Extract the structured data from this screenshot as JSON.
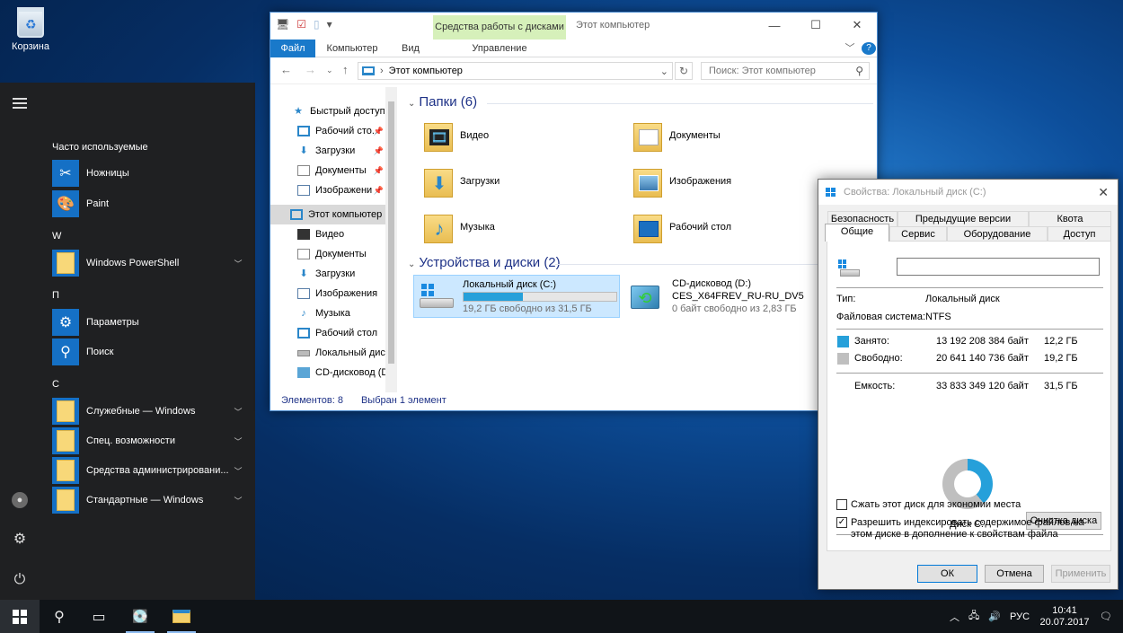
{
  "desktop": {
    "recycle_bin": "Корзина"
  },
  "start_menu": {
    "most_used_title": "Часто используемые",
    "apps": [
      {
        "label": "Ножницы"
      },
      {
        "label": "Paint"
      },
      {
        "label": "Windows PowerShell"
      },
      {
        "label": "Параметры"
      },
      {
        "label": "Поиск"
      },
      {
        "label": "Служебные — Windows"
      },
      {
        "label": "Спец. возможности"
      },
      {
        "label": "Средства администрировани..."
      },
      {
        "label": "Стандартные — Windows"
      }
    ],
    "letters": [
      "W",
      "П",
      "С"
    ]
  },
  "taskbar": {
    "lang": "РУС",
    "time": "10:41",
    "date": "20.07.2017"
  },
  "explorer": {
    "title": "Этот компьютер",
    "context_tab_title": "Средства работы с дисками",
    "ribbon_tabs": [
      "Файл",
      "Компьютер",
      "Вид",
      "Управление"
    ],
    "address": "Этот компьютер",
    "search_placeholder": "Поиск: Этот компьютер",
    "nav": {
      "quick_access": "Быстрый доступ",
      "items": [
        "Рабочий сто...",
        "Загрузки",
        "Документы",
        "Изображени",
        "Этот компьютер",
        "Видео",
        "Документы",
        "Загрузки",
        "Изображения",
        "Музыка",
        "Рабочий стол",
        "Локальный дис",
        "CD-дисковод (D"
      ]
    },
    "folders_group": "Папки (6)",
    "folders": [
      "Видео",
      "Документы",
      "Загрузки",
      "Изображения",
      "Музыка",
      "Рабочий стол"
    ],
    "drives_group": "Устройства и диски (2)",
    "drives": [
      {
        "name": "Локальный диск (C:)",
        "free": "19,2 ГБ свободно из 31,5 ГБ",
        "used_fraction": 0.39
      },
      {
        "name": "CD-дисковод (D:)",
        "label": "CES_X64FREV_RU-RU_DV5",
        "free": "0 байт свободно из 2,83 ГБ"
      }
    ],
    "status_items": "Элементов: 8",
    "status_selected": "Выбран 1 элемент"
  },
  "properties": {
    "title": "Свойства: Локальный диск (C:)",
    "tabs_top": [
      "Безопасность",
      "Предыдущие версии",
      "Квота"
    ],
    "tabs_bottom": [
      "Общие",
      "Сервис",
      "Оборудование",
      "Доступ"
    ],
    "name_value": "",
    "type_label": "Тип:",
    "type_value": "Локальный диск",
    "fs_label": "Файловая система:",
    "fs_value": "NTFS",
    "used_label": "Занято:",
    "used_bytes": "13 192 208 384 байт",
    "used_gb": "12,2 ГБ",
    "free_label": "Свободно:",
    "free_bytes": "20 641 140 736 байт",
    "free_gb": "19,2 ГБ",
    "capacity_label": "Емкость:",
    "capacity_bytes": "33 833 349 120 байт",
    "capacity_gb": "31,5 ГБ",
    "disk_label": "Диск C:",
    "cleanup_button": "Очистка диска",
    "compress_label": "Сжать этот диск для экономии места",
    "index_label": "Разрешить индексировать содержимое файлов на этом диске в дополнение к свойствам файла",
    "ok": "ОК",
    "cancel": "Отмена",
    "apply": "Применить",
    "used_color": "#26a0da",
    "free_color": "#bfbfbf",
    "used_fraction": 0.39
  }
}
